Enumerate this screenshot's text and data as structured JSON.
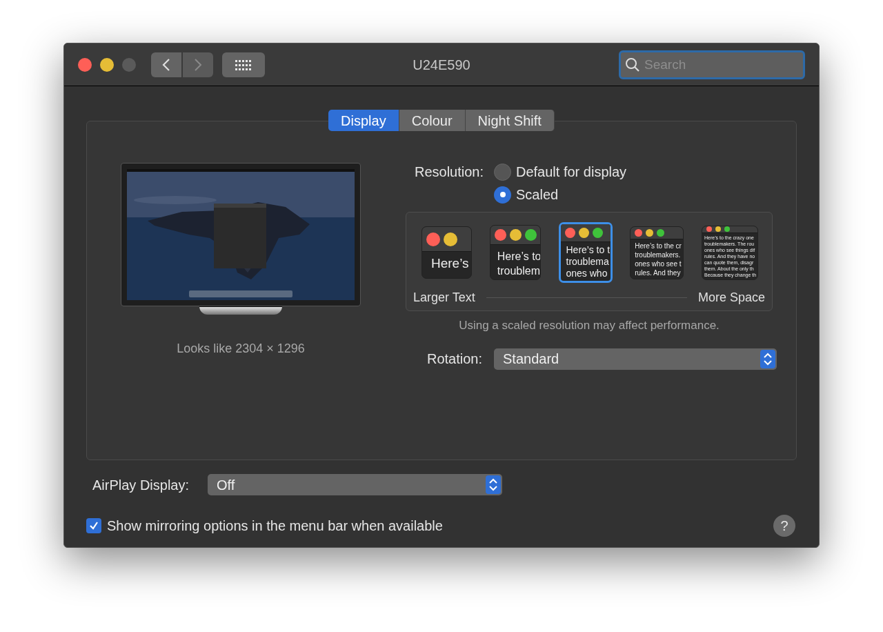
{
  "window": {
    "title": "U24E590"
  },
  "toolbar": {
    "search": {
      "placeholder": "Search"
    }
  },
  "tabs": [
    {
      "label": "Display",
      "selected": true
    },
    {
      "label": "Colour",
      "selected": false
    },
    {
      "label": "Night Shift",
      "selected": false
    }
  ],
  "display": {
    "caption": "Looks like 2304 × 1296",
    "resolution": {
      "label": "Resolution:",
      "options": [
        {
          "label": "Default for display",
          "selected": false
        },
        {
          "label": "Scaled",
          "selected": true
        }
      ]
    },
    "scale_options": [
      {
        "selected": false,
        "lines": [
          "Here’s"
        ]
      },
      {
        "selected": false,
        "lines": [
          "Here’s to",
          "troublem"
        ]
      },
      {
        "selected": true,
        "lines": [
          "Here’s to t",
          "troublema",
          "ones who"
        ]
      },
      {
        "selected": false,
        "lines": [
          "Here’s to the cr",
          "troublemakers.",
          "ones who see t",
          "rules. And they"
        ]
      },
      {
        "selected": false,
        "lines": [
          "Here’s to the crazy one",
          "troublemakers. The rou",
          "ones who see things dif",
          "rules. And they have no",
          "can quote them, disagr",
          "them. About the only th",
          "Because they change th"
        ]
      }
    ],
    "scale_min_label": "Larger Text",
    "scale_max_label": "More Space",
    "note": "Using a scaled resolution may affect performance.",
    "rotation": {
      "label": "Rotation:",
      "value": "Standard"
    }
  },
  "airplay": {
    "label": "AirPlay Display:",
    "value": "Off"
  },
  "mirroring": {
    "label": "Show mirroring options in the menu bar when available",
    "checked": true
  },
  "help": "?"
}
